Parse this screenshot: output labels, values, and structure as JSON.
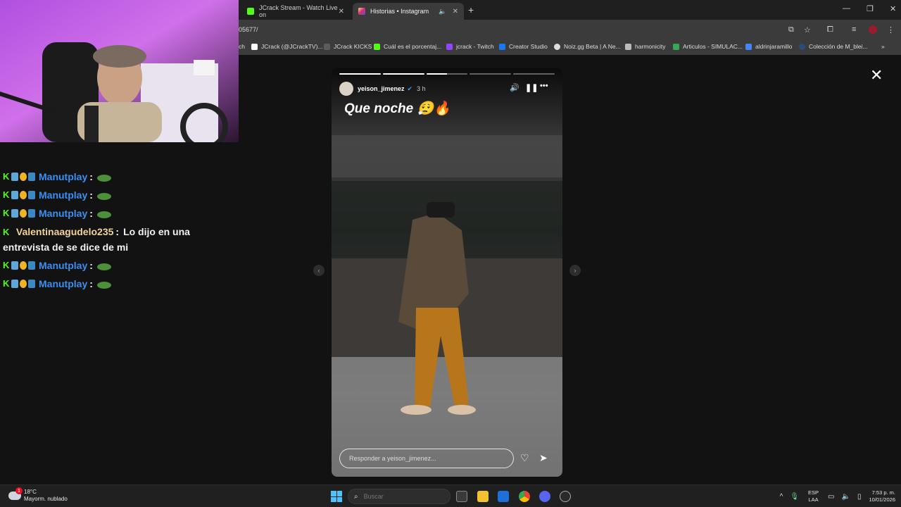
{
  "browser": {
    "tabs": [
      {
        "title": "JCrack Stream - Watch Live on",
        "icon": "kick-icon",
        "color": "#53fc18",
        "active": false
      },
      {
        "title": "Historias • Instagram",
        "icon": "instagram-icon",
        "color": "#e1306c",
        "active": true
      }
    ],
    "url": "05677/",
    "bookmarks": [
      {
        "label": "ch",
        "color": "#6441a5"
      },
      {
        "label": "JCrack (@JCrackTV)...",
        "color": "#ffffff"
      },
      {
        "label": "JCrack KICKS",
        "color": "#5b5b5b"
      },
      {
        "label": "Cuál es el porcentaj...",
        "color": "#53fc18"
      },
      {
        "label": "jcrack - Twitch",
        "color": "#9146ff"
      },
      {
        "label": "Creator Studio",
        "color": "#1877f2"
      },
      {
        "label": "Noiz.gg Beta | A Ne...",
        "color": "#dddddd"
      },
      {
        "label": "harmonicity",
        "color": "#bbbbbb"
      },
      {
        "label": "Articulos - SIMULAC...",
        "color": "#34a853"
      },
      {
        "label": "aldrinjaramillo",
        "color": "#4285f4"
      },
      {
        "label": "Colección de M_blei...",
        "color": "#2b4b7a"
      }
    ]
  },
  "chat": {
    "messages": [
      {
        "user": "Manutplay",
        "text": "",
        "user_color": "#3a8ff0",
        "emote": true
      },
      {
        "user": "Manutplay",
        "text": "",
        "user_color": "#3a8ff0",
        "emote": true
      },
      {
        "user": "Manutplay",
        "text": "",
        "user_color": "#3a8ff0",
        "emote": true
      },
      {
        "user": "Valentinaagudelo235",
        "text": "Lo dijo en una entrevista de se dice de mi",
        "user_color": "#f2d39b",
        "emote": false
      },
      {
        "user": "Manutplay",
        "text": "",
        "user_color": "#3a8ff0",
        "emote": true
      },
      {
        "user": "Manutplay",
        "text": "",
        "user_color": "#3a8ff0",
        "emote": true
      }
    ]
  },
  "story": {
    "username": "yeison_jimenez",
    "time": "3 h",
    "caption": "Que noche 😮‍💨🔥",
    "reply_placeholder": "Responder a yeison_jimenez...",
    "progress_segments": 5,
    "progress_done": 2
  },
  "taskbar": {
    "weather_temp": "18°C",
    "weather_desc": "Mayorm. nublado",
    "weather_badge": "1",
    "search_placeholder": "Buscar",
    "lang_top": "ESP",
    "lang_bottom": "LAA",
    "time": "7:53 p. m.",
    "date": "10/01/2026"
  }
}
